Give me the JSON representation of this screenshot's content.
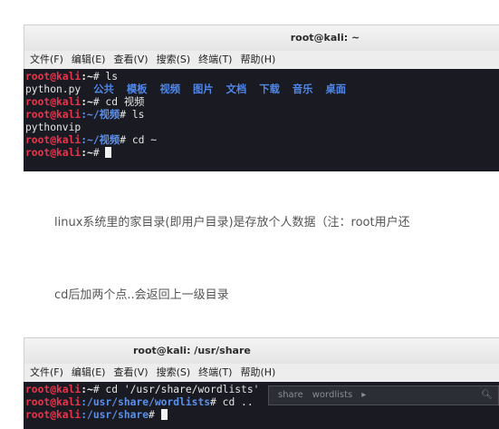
{
  "window1": {
    "title": "root@kali: ~",
    "menu": [
      "文件(F)",
      "编辑(E)",
      "查看(V)",
      "搜索(S)",
      "终端(T)",
      "帮助(H)"
    ],
    "lines": [
      {
        "user": "root@kali",
        "path": ":~",
        "cmd": "# ls"
      },
      {
        "plain": "python.py",
        "dirs": [
          "公共",
          "模板",
          "视频",
          "图片",
          "文档",
          "下载",
          "音乐",
          "桌面"
        ]
      },
      {
        "user": "root@kali",
        "path": ":~",
        "cmd": "# cd 视频"
      },
      {
        "user": "root@kali",
        "path": ":~/视频",
        "cmd": "# ls"
      },
      {
        "plain": "pythonvip"
      },
      {
        "user": "root@kali",
        "path": ":~/视频",
        "cmd": "# cd ~"
      },
      {
        "user": "root@kali",
        "path": ":~",
        "cmd": "# "
      }
    ]
  },
  "paragraph1": "linux系统里的家目录(即用户目录)是存放个人数据（注：root用户还",
  "paragraph2": "cd后加两个点..会返回上一级目录",
  "window2": {
    "title": "root@kali: /usr/share",
    "menu": [
      "文件(F)",
      "编辑(E)",
      "查看(V)",
      "搜索(S)",
      "终端(T)",
      "帮助(H)"
    ],
    "lines": [
      {
        "user": "root@kali",
        "path": ":~",
        "cmd": "# cd '/usr/share/wordlists'"
      },
      {
        "user": "root@kali",
        "path": ":/usr/share/wordlists",
        "cmd": "# cd .."
      },
      {
        "user": "root@kali",
        "path": ":/usr/share",
        "cmd": "# "
      }
    ],
    "ghost_bar": {
      "items": [
        "share",
        "wordlists",
        "▸"
      ],
      "icon": "search-icon"
    }
  }
}
